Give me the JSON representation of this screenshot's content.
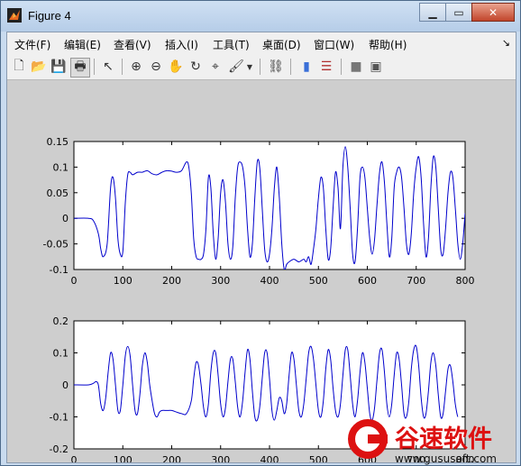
{
  "window": {
    "title": "Figure 4"
  },
  "menu": [
    "文件(F)",
    "编辑(E)",
    "查看(V)",
    "插入(I)",
    "工具(T)",
    "桌面(D)",
    "窗口(W)",
    "帮助(H)"
  ],
  "toolbar": [
    {
      "name": "new-figure-icon",
      "glyph": "🗋"
    },
    {
      "name": "open-file-icon",
      "glyph": "📂"
    },
    {
      "name": "save-icon",
      "glyph": "💾"
    },
    {
      "name": "print-icon",
      "glyph": "🖶"
    },
    {
      "name": "edit-plot-arrow-icon",
      "glyph": "↖"
    },
    {
      "name": "zoom-in-icon",
      "glyph": "⊕"
    },
    {
      "name": "zoom-out-icon",
      "glyph": "⊖"
    },
    {
      "name": "pan-hand-icon",
      "glyph": "✋"
    },
    {
      "name": "rotate-3d-icon",
      "glyph": "↻"
    },
    {
      "name": "data-cursor-icon",
      "glyph": "⌖"
    },
    {
      "name": "brush-icon",
      "glyph": "🖌"
    },
    {
      "name": "link-plot-icon",
      "glyph": "⛓"
    },
    {
      "name": "colorbar-icon",
      "glyph": "▮"
    },
    {
      "name": "legend-icon",
      "glyph": "☰"
    },
    {
      "name": "hide-plot-tools-icon",
      "glyph": "■"
    },
    {
      "name": "show-plot-tools-icon",
      "glyph": "▣"
    }
  ],
  "colors": {
    "line": "#0000cc",
    "figure_bg": "#cecece",
    "axes_bg": "#ffffff"
  },
  "watermark": {
    "brand": "谷速软件",
    "url": "www.gususoft.com"
  },
  "chart_data": [
    {
      "type": "line",
      "xlim": [
        0,
        800
      ],
      "ylim": [
        -0.1,
        0.15
      ],
      "xticks": [
        0,
        100,
        200,
        300,
        400,
        500,
        600,
        700,
        800
      ],
      "yticks": [
        -0.1,
        -0.05,
        0,
        0.05,
        0.1,
        0.15
      ],
      "x": [
        0,
        30,
        40,
        50,
        55,
        60,
        68,
        75,
        80,
        85,
        90,
        95,
        100,
        105,
        110,
        115,
        120,
        130,
        140,
        150,
        160,
        170,
        180,
        190,
        200,
        210,
        220,
        230,
        235,
        240,
        245,
        250,
        255,
        260,
        265,
        270,
        275,
        280,
        285,
        290,
        295,
        300,
        305,
        310,
        315,
        320,
        325,
        330,
        335,
        340,
        345,
        350,
        355,
        360,
        365,
        370,
        375,
        380,
        385,
        390,
        395,
        400,
        405,
        410,
        415,
        420,
        425,
        430,
        435,
        440,
        450,
        460,
        470,
        475,
        480,
        485,
        490,
        495,
        500,
        505,
        510,
        515,
        520,
        525,
        530,
        535,
        540,
        545,
        550,
        555,
        560,
        565,
        570,
        575,
        580,
        585,
        590,
        595,
        600,
        605,
        610,
        615,
        620,
        625,
        630,
        635,
        640,
        645,
        650,
        655,
        660,
        665,
        670,
        675,
        680,
        685,
        690,
        695,
        700,
        705,
        710,
        715,
        720,
        725,
        730,
        735,
        740,
        745,
        750,
        755,
        760,
        765,
        770,
        775,
        780,
        785,
        790,
        795,
        800
      ],
      "y": [
        0,
        0,
        -0.005,
        -0.03,
        -0.06,
        -0.075,
        -0.05,
        0.06,
        0.08,
        0.04,
        -0.04,
        -0.07,
        -0.065,
        0.03,
        0.085,
        0.09,
        0.085,
        0.09,
        0.09,
        0.093,
        0.087,
        0.085,
        0.09,
        0.093,
        0.092,
        0.09,
        0.093,
        0.11,
        0.1,
        0.05,
        -0.04,
        -0.075,
        -0.08,
        -0.08,
        -0.07,
        -0.02,
        0.08,
        0.06,
        -0.03,
        -0.08,
        -0.04,
        0.05,
        0.075,
        0.03,
        -0.05,
        -0.08,
        -0.055,
        0.04,
        0.1,
        0.11,
        0.1,
        0.06,
        -0.02,
        -0.075,
        -0.05,
        0.04,
        0.11,
        0.1,
        0.02,
        -0.06,
        -0.085,
        -0.07,
        -0.02,
        0.06,
        0.1,
        0.04,
        -0.05,
        -0.1,
        -0.09,
        -0.085,
        -0.08,
        -0.085,
        -0.08,
        -0.085,
        -0.075,
        -0.09,
        -0.06,
        -0.02,
        0.04,
        0.08,
        0.06,
        -0.02,
        -0.08,
        -0.06,
        0.02,
        0.09,
        0.06,
        -0.02,
        0.1,
        0.14,
        0.1,
        0.02,
        -0.07,
        -0.085,
        -0.02,
        0.08,
        0.1,
        0.08,
        0.02,
        -0.04,
        -0.07,
        -0.04,
        0.03,
        0.09,
        0.11,
        0.07,
        -0.01,
        -0.075,
        -0.04,
        0.06,
        0.09,
        0.1,
        0.08,
        0.02,
        -0.05,
        -0.07,
        -0.03,
        0.05,
        0.1,
        0.12,
        0.08,
        -0.01,
        -0.075,
        -0.04,
        0.06,
        0.12,
        0.1,
        0.02,
        -0.06,
        -0.07,
        -0.02,
        0.05,
        0.09,
        0.08,
        0.02,
        -0.05,
        -0.08,
        -0.05,
        0.01
      ]
    },
    {
      "type": "line",
      "xlim": [
        0,
        800
      ],
      "ylim": [
        -0.2,
        0.2
      ],
      "xticks": [
        0,
        100,
        200,
        300,
        400,
        500,
        600,
        700,
        800
      ],
      "yticks": [
        -0.2,
        -0.1,
        0,
        0.1,
        0.2
      ],
      "x": [
        0,
        30,
        40,
        45,
        50,
        55,
        60,
        65,
        70,
        75,
        80,
        85,
        90,
        95,
        100,
        105,
        110,
        115,
        120,
        125,
        130,
        135,
        140,
        145,
        150,
        155,
        160,
        165,
        170,
        175,
        180,
        190,
        200,
        210,
        220,
        230,
        240,
        245,
        250,
        255,
        260,
        265,
        270,
        275,
        280,
        285,
        290,
        295,
        300,
        305,
        310,
        315,
        320,
        325,
        330,
        335,
        340,
        345,
        350,
        355,
        360,
        365,
        370,
        375,
        380,
        385,
        390,
        395,
        400,
        405,
        410,
        415,
        420,
        425,
        430,
        435,
        440,
        445,
        450,
        455,
        460,
        465,
        470,
        475,
        480,
        485,
        490,
        495,
        500,
        505,
        510,
        515,
        520,
        525,
        530,
        535,
        540,
        545,
        550,
        555,
        560,
        565,
        570,
        575,
        580,
        585,
        590,
        595,
        600,
        605,
        610,
        615,
        620,
        625,
        630,
        635,
        640,
        645,
        650,
        655,
        660,
        665,
        670,
        675,
        680,
        685,
        690,
        695,
        700,
        705,
        710,
        715,
        720,
        725,
        730,
        735,
        740,
        745,
        750,
        755,
        760,
        765,
        770,
        775,
        780,
        785,
        790,
        795,
        800
      ],
      "y": [
        0,
        0,
        0.005,
        0.01,
        0,
        -0.06,
        -0.08,
        -0.04,
        0.04,
        0.1,
        0.08,
        0,
        -0.08,
        -0.08,
        0,
        0.09,
        0.12,
        0.09,
        0,
        -0.08,
        -0.09,
        -0.03,
        0.06,
        0.1,
        0.07,
        0,
        -0.05,
        -0.09,
        -0.1,
        -0.085,
        -0.08,
        -0.08,
        -0.08,
        -0.085,
        -0.09,
        -0.09,
        -0.05,
        0.02,
        0.07,
        0.06,
        0,
        -0.07,
        -0.1,
        -0.06,
        0.04,
        0.1,
        0.1,
        0.03,
        -0.06,
        -0.1,
        -0.07,
        0.01,
        0.08,
        0.08,
        0.01,
        -0.07,
        -0.1,
        -0.05,
        0.04,
        0.11,
        0.08,
        -0.02,
        -0.1,
        -0.11,
        -0.07,
        0.02,
        0.1,
        0.1,
        0.02,
        -0.08,
        -0.11,
        -0.08,
        -0.04,
        -0.05,
        -0.09,
        -0.06,
        0.03,
        0.1,
        0.08,
        0,
        -0.08,
        -0.1,
        -0.06,
        0.02,
        0.1,
        0.12,
        0.08,
        0,
        -0.08,
        -0.1,
        -0.05,
        0.05,
        0.11,
        0.08,
        -0.01,
        -0.08,
        -0.1,
        -0.06,
        0.03,
        0.11,
        0.11,
        0.03,
        -0.06,
        -0.1,
        -0.05,
        0.04,
        0.1,
        0.07,
        -0.01,
        -0.09,
        -0.11,
        -0.07,
        0.02,
        0.1,
        0.11,
        0.04,
        -0.06,
        -0.1,
        -0.06,
        0.03,
        0.1,
        0.08,
        0,
        -0.09,
        -0.1,
        -0.05,
        0.05,
        0.11,
        0.12,
        0.06,
        -0.04,
        -0.1,
        -0.09,
        -0.02,
        0.07,
        0.1,
        0.06,
        -0.03,
        -0.1,
        -0.09,
        -0.02,
        0.05,
        0.06,
        0.01,
        -0.06,
        -0.1,
        -0.1
      ]
    }
  ]
}
